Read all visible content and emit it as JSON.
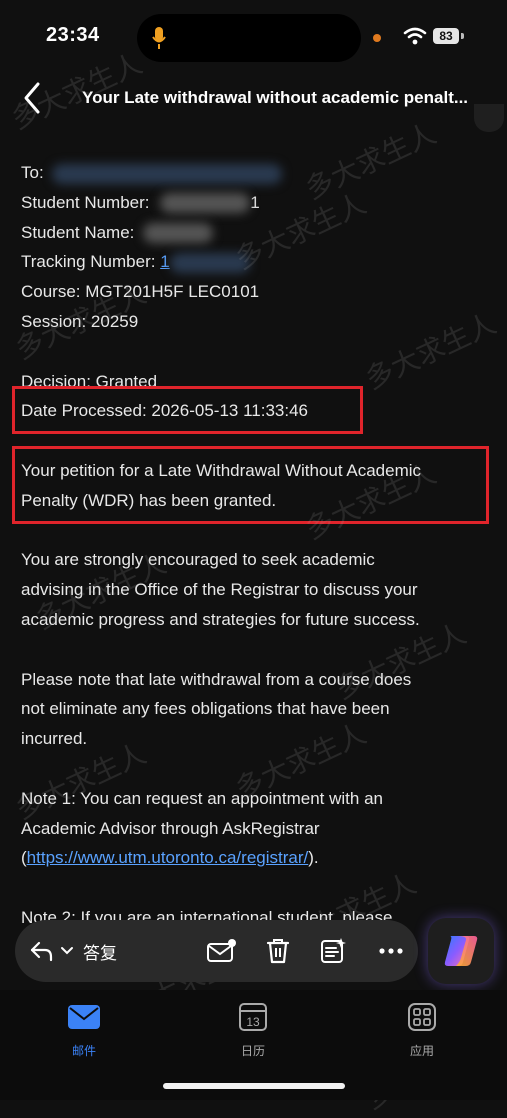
{
  "status_bar": {
    "time": "23:34",
    "battery": "83"
  },
  "header": {
    "title": "Your Late withdrawal without academic penalt..."
  },
  "email": {
    "to_label": "To:",
    "student_number_label": "Student Number:",
    "student_number_tail": "1",
    "student_name_label": "Student Name:",
    "tracking_label": "Tracking Number:",
    "tracking_tail": "1",
    "course": "Course: MGT201H5F  LEC0101",
    "session": "Session: 20259",
    "decision": "Decision: Granted",
    "date_processed": "Date Processed: 2026-05-13 11:33:46",
    "p1_l1": "Your petition for a Late Withdrawal Without Academic",
    "p1_l2": "Penalty (WDR) has been granted.",
    "p2_l1": "You are strongly encouraged to seek academic",
    "p2_l2": "advising in the Office of the Registrar to discuss your",
    "p2_l3": "academic progress and strategies for future success.",
    "p3_l1": "Please note that late withdrawal from a course does",
    "p3_l2": "not eliminate any fees obligations that have been",
    "p3_l3": "incurred.",
    "n1_l1": "Note 1: You can request an appointment with an",
    "n1_l2": "Academic Advisor through AskRegistrar",
    "n1_open": "(",
    "n1_link": "https://www.utm.utoronto.ca/registrar/",
    "n1_close": ").",
    "n2_l1": "Note 2: If you are an international student, please"
  },
  "toolbar": {
    "reply": "答复"
  },
  "tabs": [
    {
      "label": "邮件",
      "icon": "mail-icon"
    },
    {
      "label": "日历",
      "icon": "calendar-icon",
      "calendar_day": "13"
    },
    {
      "label": "应用",
      "icon": "apps-icon"
    }
  ],
  "watermark": "多大求生人",
  "colors": {
    "accent": "#3b82f6",
    "highlight_box": "#e0242b",
    "link": "#5aa2ff"
  }
}
